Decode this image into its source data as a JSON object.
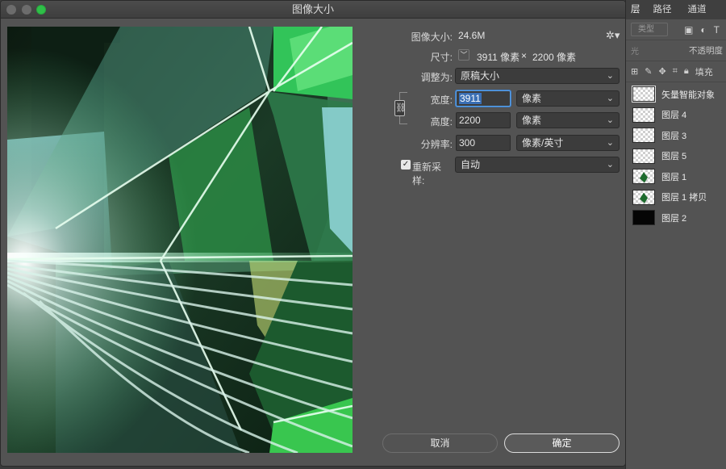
{
  "window": {
    "title": "图像大小"
  },
  "layers_panel": {
    "tabs": [
      "路径",
      "通道"
    ],
    "filter_kind": "类型",
    "opacity_label": "不透明度",
    "fill_label": "填充",
    "layers": [
      {
        "name": "矢量智能对象",
        "selected": true
      },
      {
        "name": "图层 4"
      },
      {
        "name": "图层 3"
      },
      {
        "name": "图层 5"
      },
      {
        "name": "图层 1"
      },
      {
        "name": "图层 1 拷贝"
      },
      {
        "name": "图层 2"
      }
    ]
  },
  "info": {
    "image_size_label": "图像大小:",
    "image_size_value": "24.6M",
    "dimensions_label": "尺寸:",
    "dim_width": "3911 像素",
    "dim_x": "×",
    "dim_height": "2200 像素"
  },
  "form": {
    "fit_to_label": "调整为:",
    "fit_to_value": "原稿大小",
    "width_label": "宽度:",
    "width_value": "3911",
    "width_unit": "像素",
    "height_label": "高度:",
    "height_value": "2200",
    "height_unit": "像素",
    "resolution_label": "分辨率:",
    "resolution_value": "300",
    "resolution_unit": "像素/英寸",
    "resample_label": "重新采样:",
    "resample_checked": true,
    "resample_value": "自动"
  },
  "buttons": {
    "cancel": "取消",
    "ok": "确定"
  },
  "colors": {
    "dialog_bg": "#535353",
    "accent": "#3a6fb5",
    "preview_green": "#2fbf48"
  }
}
